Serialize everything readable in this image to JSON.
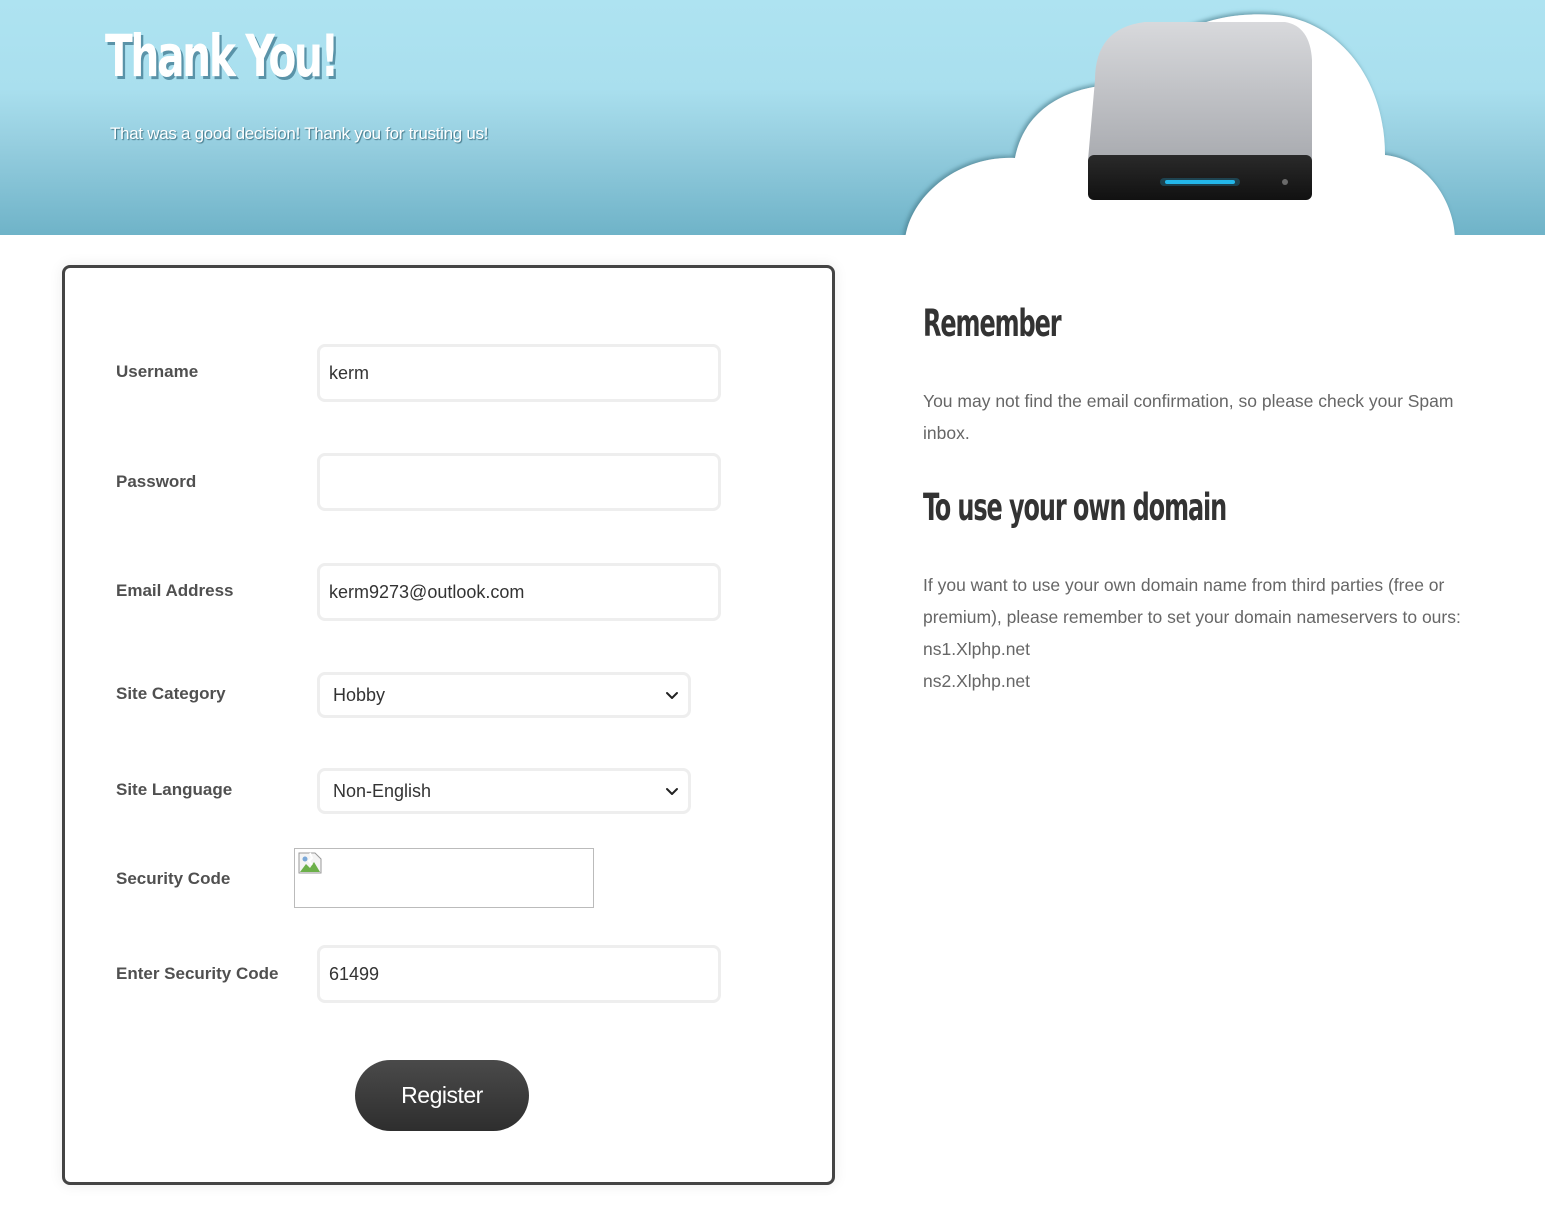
{
  "header": {
    "title": "Thank You!",
    "subtitle": "That was a good decision! Thank you for trusting us!"
  },
  "form": {
    "fields": {
      "username": {
        "label": "Username",
        "value": "kerm"
      },
      "password": {
        "label": "Password",
        "value": ""
      },
      "email": {
        "label": "Email Address",
        "value": "kerm9273@outlook.com"
      },
      "site_category": {
        "label": "Site Category",
        "value": "Hobby"
      },
      "site_language": {
        "label": "Site Language",
        "value": "Non-English"
      },
      "security_code": {
        "label": "Security Code"
      },
      "enter_security_code": {
        "label": "Enter Security Code",
        "value": "61499"
      }
    },
    "register_label": "Register"
  },
  "sidebar": {
    "remember_heading": "Remember",
    "remember_text": "You may not find the email confirmation, so please check your Spam inbox.",
    "domain_heading": "To use your own domain",
    "domain_text": "If you want to use your own domain name from third parties (free or premium), please remember to set your domain nameservers to ours:",
    "nameservers": [
      "ns1.Xlphp.net",
      "ns2.Xlphp.net"
    ]
  },
  "icons": {
    "cloud_server": "cloud-server-icon",
    "chevron": "chevron-down-icon",
    "broken_image": "broken-image-icon"
  },
  "colors": {
    "header_sky": "#aee3f1",
    "header_bottom": "#6fb3c8",
    "form_border": "#444444",
    "button_bg": "#333333",
    "text_gray": "#666666"
  }
}
